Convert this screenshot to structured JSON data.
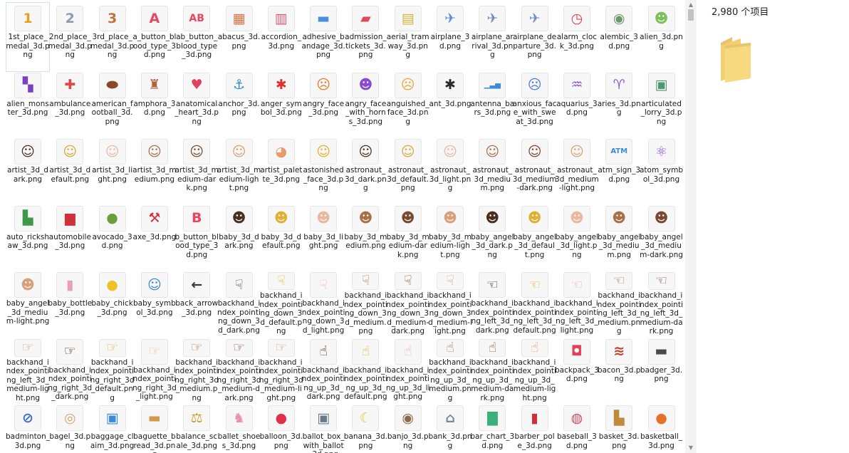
{
  "status": {
    "item_count": "2,980 个项目"
  },
  "files": [
    {
      "name": "1st_place_medal_3d.png",
      "glyph": "1",
      "color": "#e3a21a"
    },
    {
      "name": "2nd_place_medal_3d.png",
      "glyph": "2",
      "color": "#8e9bb0"
    },
    {
      "name": "3rd_place_medal_3d.png",
      "glyph": "3",
      "color": "#c2733a"
    },
    {
      "name": "a_button_blood_type_3d.png",
      "glyph": "A",
      "color": "#e8455f"
    },
    {
      "name": "ab_button_blood_type_3d.png",
      "glyph": "AB",
      "color": "#e8455f"
    },
    {
      "name": "abacus_3d.png",
      "glyph": "▦",
      "color": "#d9734a"
    },
    {
      "name": "accordion_3d.png",
      "glyph": "▥",
      "color": "#e05a7a"
    },
    {
      "name": "adhesive_bandage_3d.png",
      "glyph": "▬",
      "color": "#4a8fe0"
    },
    {
      "name": "admission_tickets_3d.png",
      "glyph": "▰",
      "color": "#e0495a"
    },
    {
      "name": "aerial_tramway_3d.png",
      "glyph": "▤",
      "color": "#d8b23a"
    },
    {
      "name": "airplane_3d.png",
      "glyph": "✈",
      "color": "#5a8fd8"
    },
    {
      "name": "airplane_arrival_3d.png",
      "glyph": "✈",
      "color": "#6d8fb8"
    },
    {
      "name": "airplane_departure_3d.png",
      "glyph": "✈",
      "color": "#6d8fb8"
    },
    {
      "name": "alarm_clock_3d.png",
      "glyph": "◷",
      "color": "#e0404a"
    },
    {
      "name": "alembic_3d.png",
      "glyph": "◉",
      "color": "#6a9a6a"
    },
    {
      "name": "alien_3d.png",
      "glyph": "☻",
      "color": "#7ac25a"
    },
    {
      "name": "alien_monster_3d.png",
      "glyph": "▚",
      "color": "#7a3fc2"
    },
    {
      "name": "ambulance_3d.png",
      "glyph": "✚",
      "color": "#e04a4a"
    },
    {
      "name": "american_football_3d.png",
      "glyph": "⬬",
      "color": "#8a4a2a"
    },
    {
      "name": "amphora_3d.png",
      "glyph": "♜",
      "color": "#b0643a"
    },
    {
      "name": "anatomical_heart_3d.png",
      "glyph": "♥",
      "color": "#e0405a"
    },
    {
      "name": "anchor_3d.png",
      "glyph": "⚓",
      "color": "#3a8ad8"
    },
    {
      "name": "anger_symbol_3d.png",
      "glyph": "✱",
      "color": "#e0302a"
    },
    {
      "name": "angry_face_3d.png",
      "glyph": "☹",
      "color": "#e8782a"
    },
    {
      "name": "angry_face_with_horns_3d.png",
      "glyph": "☻",
      "color": "#8a4ad0"
    },
    {
      "name": "anguished_face_3d.png",
      "glyph": "☹",
      "color": "#e8a82a"
    },
    {
      "name": "ant_3d.png",
      "glyph": "✱",
      "color": "#2a2a2a"
    },
    {
      "name": "antenna_bars_3d.png",
      "glyph": "▁▃▅",
      "color": "#3a8ae0"
    },
    {
      "name": "anxious_face_with_sweat_3d.png",
      "glyph": "☹",
      "color": "#4a7ad8"
    },
    {
      "name": "aquarius_3d.png",
      "glyph": "♒",
      "color": "#8a5ad8"
    },
    {
      "name": "aries_3d.png",
      "glyph": "♈",
      "color": "#8a5ad8"
    },
    {
      "name": "articulated_lorry_3d.png",
      "glyph": "▣",
      "color": "#4a9a6a"
    },
    {
      "name": "artist_3d_dark.png",
      "glyph": "☺",
      "color": "#4a2e20"
    },
    {
      "name": "artist_3d_default.png",
      "glyph": "☺",
      "color": "#d9a83a"
    },
    {
      "name": "artist_3d_light.png",
      "glyph": "☺",
      "color": "#e8b8a0"
    },
    {
      "name": "artist_3d_medium.png",
      "glyph": "☺",
      "color": "#a8704a"
    },
    {
      "name": "artist_3d_medium-dark.png",
      "glyph": "☺",
      "color": "#7a4a30"
    },
    {
      "name": "artist_3d_medium-light.png",
      "glyph": "☺",
      "color": "#d8a07a"
    },
    {
      "name": "artist_palette_3d.png",
      "glyph": "◕",
      "color": "#e89a6a"
    },
    {
      "name": "astonished_face_3d.png",
      "glyph": "☺",
      "color": "#e8b02a"
    },
    {
      "name": "astronaut_3d_dark.png",
      "glyph": "☺",
      "color": "#4a2e20"
    },
    {
      "name": "astronaut_3d_default.png",
      "glyph": "☺",
      "color": "#d9a83a"
    },
    {
      "name": "astronaut_3d_light.png",
      "glyph": "☺",
      "color": "#e8b8a0"
    },
    {
      "name": "astronaut_3d_medium.png",
      "glyph": "☺",
      "color": "#a8704a"
    },
    {
      "name": "astronaut_3d_medium-dark.png",
      "glyph": "☺",
      "color": "#7a4a30"
    },
    {
      "name": "astronaut_3d_medium-light.png",
      "glyph": "☺",
      "color": "#d8a07a"
    },
    {
      "name": "atm_sign_3d.png",
      "glyph": "ATM",
      "color": "#3a8ae0"
    },
    {
      "name": "atom_symbol_3d.png",
      "glyph": "⚛",
      "color": "#8a5ad8"
    },
    {
      "name": "auto_rickshaw_3d.png",
      "glyph": "▙",
      "color": "#3a9a4a"
    },
    {
      "name": "automobile_3d.png",
      "glyph": "▆",
      "color": "#d0303a"
    },
    {
      "name": "avocado_3d.png",
      "glyph": "●",
      "color": "#6aa03a"
    },
    {
      "name": "axe_3d.png",
      "glyph": "⚒",
      "color": "#d0303a"
    },
    {
      "name": "b_button_blood_type_3d.png",
      "glyph": "B",
      "color": "#e8455f"
    },
    {
      "name": "baby_3d_dark.png",
      "glyph": "☻",
      "color": "#4a2e20"
    },
    {
      "name": "baby_3d_default.png",
      "glyph": "☻",
      "color": "#e0b030"
    },
    {
      "name": "baby_3d_light.png",
      "glyph": "☻",
      "color": "#e8b8a0"
    },
    {
      "name": "baby_3d_medium.png",
      "glyph": "☻",
      "color": "#a8704a"
    },
    {
      "name": "baby_3d_medium-dark.png",
      "glyph": "☻",
      "color": "#7a4a30"
    },
    {
      "name": "baby_3d_medium-light.png",
      "glyph": "☻",
      "color": "#d8a07a"
    },
    {
      "name": "baby_angel_3d_dark.png",
      "glyph": "☻",
      "color": "#4a2e20"
    },
    {
      "name": "baby_angel_3d_default.png",
      "glyph": "☻",
      "color": "#e0b030"
    },
    {
      "name": "baby_angel_3d_light.png",
      "glyph": "☻",
      "color": "#e8b8a0"
    },
    {
      "name": "baby_angel_3d_medium.png",
      "glyph": "☻",
      "color": "#a8704a"
    },
    {
      "name": "baby_angel_3d_medium-dark.png",
      "glyph": "☻",
      "color": "#7a4a30"
    },
    {
      "name": "baby_angel_3d_medium-light.png",
      "glyph": "☻",
      "color": "#d8a07a"
    },
    {
      "name": "baby_bottle_3d.png",
      "glyph": "▮",
      "color": "#e8a0b8"
    },
    {
      "name": "baby_chick_3d.png",
      "glyph": "●",
      "color": "#f0c02a"
    },
    {
      "name": "baby_symbol_3d.png",
      "glyph": "☺",
      "color": "#3a8ae0"
    },
    {
      "name": "back_arrow_3d.png",
      "glyph": "←",
      "color": "#3a3a3a"
    },
    {
      "name": "backhand_index_pointing_down_3d_dark.png",
      "glyph": "☟",
      "color": "#4a2e20"
    },
    {
      "name": "backhand_index_pointing_down_3d_default.png",
      "glyph": "☟",
      "color": "#e0b030"
    },
    {
      "name": "backhand_index_pointing_down_3d_light.png",
      "glyph": "☟",
      "color": "#e8b8a0"
    },
    {
      "name": "backhand_index_pointing_down_3d_medium.png",
      "glyph": "☟",
      "color": "#a8704a"
    },
    {
      "name": "backhand_index_pointing_down_3d_medium-dark.png",
      "glyph": "☟",
      "color": "#7a4a30"
    },
    {
      "name": "backhand_index_pointing_down_3d_medium-light.png",
      "glyph": "☟",
      "color": "#d8a07a"
    },
    {
      "name": "backhand_index_pointing_left_3d_dark.png",
      "glyph": "☜",
      "color": "#2a1a10"
    },
    {
      "name": "backhand_index_pointing_left_3d_default.png",
      "glyph": "☜",
      "color": "#e0b030"
    },
    {
      "name": "backhand_index_pointing_left_3d_light.png",
      "glyph": "☜",
      "color": "#e8b8a0"
    },
    {
      "name": "backhand_index_pointing_left_3d_medium.png",
      "glyph": "☜",
      "color": "#a8704a"
    },
    {
      "name": "backhand_index_pointing_left_3d_medium-dark.png",
      "glyph": "☜",
      "color": "#7a4a30"
    },
    {
      "name": "backhand_index_pointing_left_3d_medium-light.png",
      "glyph": "☞",
      "color": "#d8a07a"
    },
    {
      "name": "backhand_index_pointing_right_3d_dark.png",
      "glyph": "☞",
      "color": "#2a1a10"
    },
    {
      "name": "backhand_index_pointing_right_3d_default.png",
      "glyph": "☞",
      "color": "#e0b030"
    },
    {
      "name": "backhand_index_pointing_right_3d_light.png",
      "glyph": "☞",
      "color": "#e8b8a0"
    },
    {
      "name": "backhand_index_pointing_right_3d_medium.png",
      "glyph": "☞",
      "color": "#a8704a"
    },
    {
      "name": "backhand_index_pointing_right_3d_medium-dark.png",
      "glyph": "☞",
      "color": "#7a4a30"
    },
    {
      "name": "backhand_index_pointing_right_3d_medium-light.png",
      "glyph": "☞",
      "color": "#d8a07a"
    },
    {
      "name": "backhand_index_pointing_up_3d_dark.png",
      "glyph": "☝",
      "color": "#2a1a10"
    },
    {
      "name": "backhand_index_pointing_up_3d_default.png",
      "glyph": "☝",
      "color": "#e0b030"
    },
    {
      "name": "backhand_index_pointing_up_3d_light.png",
      "glyph": "☝",
      "color": "#e8b8a0"
    },
    {
      "name": "backhand_index_pointing_up_3d_medium.png",
      "glyph": "☝",
      "color": "#a8704a"
    },
    {
      "name": "backhand_index_pointing_up_3d_medium-dark.png",
      "glyph": "☝",
      "color": "#7a4a30"
    },
    {
      "name": "backhand_index_pointing_up_3d_medium-light.png",
      "glyph": "☝",
      "color": "#d8a07a"
    },
    {
      "name": "backpack_3d.png",
      "glyph": "◘",
      "color": "#e0405a"
    },
    {
      "name": "bacon_3d.png",
      "glyph": "≋",
      "color": "#c0402a"
    },
    {
      "name": "badger_3d.png",
      "glyph": "▬",
      "color": "#4a4a4a"
    },
    {
      "name": "badminton_3d.png",
      "glyph": "⊘",
      "color": "#3a6ad8"
    },
    {
      "name": "bagel_3d.png",
      "glyph": "◎",
      "color": "#e0a070"
    },
    {
      "name": "baggage_claim_3d.png",
      "glyph": "▣",
      "color": "#3a8ae0"
    },
    {
      "name": "baguette_bread_3d.png",
      "glyph": "▬",
      "color": "#d09a4a"
    },
    {
      "name": "balance_scale_3d.png",
      "glyph": "⚖",
      "color": "#d0a02a"
    },
    {
      "name": "ballet_shoes_3d.png",
      "glyph": "♞",
      "color": "#e890a8"
    },
    {
      "name": "balloon_3d.png",
      "glyph": "●",
      "color": "#e0304a"
    },
    {
      "name": "ballot_box_with_ballot_3d.png",
      "glyph": "▣",
      "color": "#6a7a8a"
    },
    {
      "name": "banana_3d.png",
      "glyph": "☾",
      "color": "#f0c02a"
    },
    {
      "name": "banjo_3d.png",
      "glyph": "◉",
      "color": "#8a6a4a"
    },
    {
      "name": "bank_3d.png",
      "glyph": "⌂",
      "color": "#7a8a9a"
    },
    {
      "name": "bar_chart_3d.png",
      "glyph": "▇",
      "color": "#3ab07a"
    },
    {
      "name": "barber_pole_3d.png",
      "glyph": "▮",
      "color": "#d0303a"
    },
    {
      "name": "baseball_3d.png",
      "glyph": "◍",
      "color": "#d04a5a"
    },
    {
      "name": "basket_3d.png",
      "glyph": "▙",
      "color": "#c08a3a"
    },
    {
      "name": "basketball_3d.png",
      "glyph": "●",
      "color": "#e8702a"
    }
  ]
}
